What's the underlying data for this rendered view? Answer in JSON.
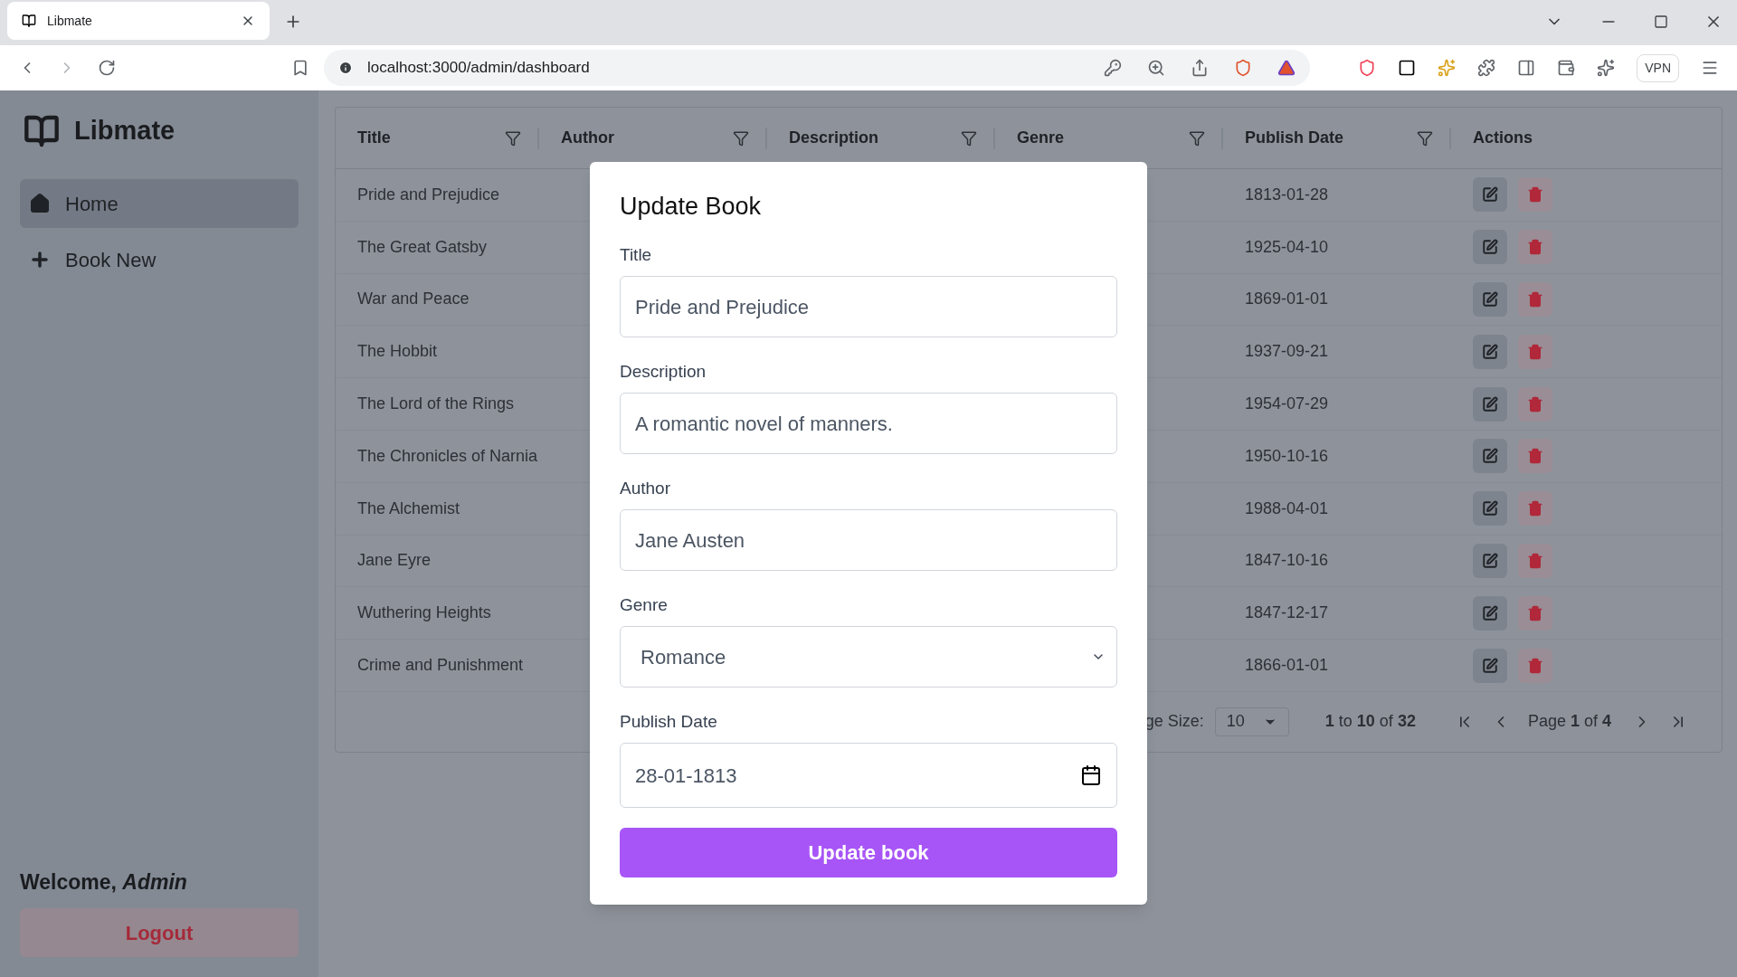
{
  "browser": {
    "tab_title": "Libmate",
    "url": "localhost:3000/admin/dashboard",
    "vpn": "VPN"
  },
  "sidebar": {
    "brand": "Libmate",
    "items": [
      {
        "label": "Home",
        "kind": "home",
        "selected": true
      },
      {
        "label": "Book New",
        "kind": "add",
        "selected": false
      }
    ],
    "welcome": "Welcome, *Admin*",
    "logout": "Logout"
  },
  "table": {
    "columns": [
      {
        "label": "Title",
        "filter": true
      },
      {
        "label": "Author",
        "filter": true
      },
      {
        "label": "Description",
        "filter": true
      },
      {
        "label": "Genre",
        "filter": true
      },
      {
        "label": "Publish Date",
        "filter": true
      },
      {
        "label": "Actions",
        "filter": false
      }
    ],
    "rows": [
      {
        "title": "Pride and Prejudice",
        "publish_date": "1813-01-28"
      },
      {
        "title": "The Great Gatsby",
        "publish_date": "1925-04-10"
      },
      {
        "title": "War and Peace",
        "publish_date": "1869-01-01"
      },
      {
        "title": "The Hobbit",
        "publish_date": "1937-09-21"
      },
      {
        "title": "The Lord of the Rings",
        "publish_date": "1954-07-29"
      },
      {
        "title": "The Chronicles of Narnia",
        "publish_date": "1950-10-16"
      },
      {
        "title": "The Alchemist",
        "publish_date": "1988-04-01"
      },
      {
        "title": "Jane Eyre",
        "publish_date": "1847-10-16"
      },
      {
        "title": "Wuthering Heights",
        "publish_date": "1847-12-17"
      },
      {
        "title": "Crime and Punishment",
        "publish_date": "1866-01-01"
      }
    ],
    "pagination": {
      "page_size_label": "ge Size:",
      "page_size": "10",
      "range": "**1** to **10** of **32**",
      "page": "Page **1** of **4**"
    }
  },
  "modal": {
    "title": "Update Book",
    "fields": [
      {
        "label": "Title",
        "kind": "text",
        "value": "Pride and Prejudice"
      },
      {
        "label": "Description",
        "kind": "text",
        "value": "A romantic novel of manners."
      },
      {
        "label": "Author",
        "kind": "text",
        "value": "Jane Austen"
      },
      {
        "label": "Genre",
        "kind": "select",
        "value": "Romance"
      },
      {
        "label": "Publish Date",
        "kind": "date",
        "value": "28-01-1813"
      }
    ],
    "submit": "Update book"
  }
}
